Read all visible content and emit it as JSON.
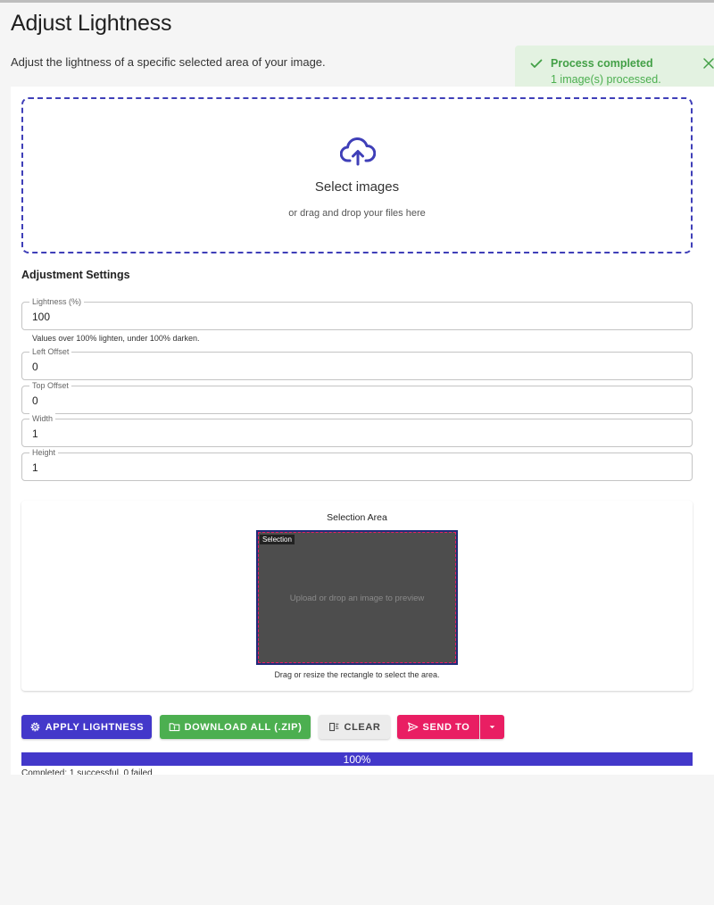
{
  "page": {
    "title": "Adjust Lightness",
    "description": "Adjust the lightness of a specific selected area of your image."
  },
  "toast": {
    "title": "Process completed",
    "message": "1 image(s) processed.",
    "color": "#43a047",
    "icons": [
      "check-icon",
      "close-icon"
    ]
  },
  "upload": {
    "icon": "cloud-upload-icon",
    "title": "Select images",
    "subtitle": "or drag and drop your files here"
  },
  "settings": {
    "heading": "Adjustment Settings",
    "lightness": {
      "label": "Lightness (%)",
      "value": "100",
      "helper": "Values over 100% lighten, under 100% darken."
    },
    "left_offset": {
      "label": "Left Offset",
      "value": "0"
    },
    "top_offset": {
      "label": "Top Offset",
      "value": "0"
    },
    "width": {
      "label": "Width",
      "value": "1"
    },
    "height": {
      "label": "Height",
      "value": "1"
    }
  },
  "selection": {
    "title": "Selection Area",
    "tag": "Selection",
    "placeholder": "Upload or drop an image to preview",
    "hint": "Drag or resize the rectangle to select the area."
  },
  "actions": {
    "apply": "APPLY LIGHTNESS",
    "download": "DOWNLOAD ALL (.ZIP)",
    "clear": "CLEAR",
    "send": "SEND TO"
  },
  "progress": {
    "percent": 100,
    "label": "100%",
    "status": "Completed: 1 successful, 0 failed"
  },
  "colors": {
    "primary": "#4338ca",
    "success": "#4caf50",
    "accent": "#e91e63",
    "clear": "#ececec"
  }
}
